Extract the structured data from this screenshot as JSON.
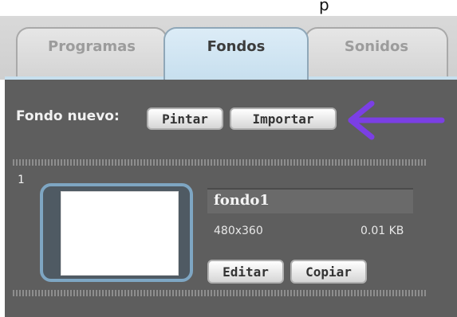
{
  "tabs": [
    {
      "label": "Programas",
      "active": false
    },
    {
      "label": "Fondos",
      "active": true
    },
    {
      "label": "Sonidos",
      "active": false
    }
  ],
  "new_background": {
    "label": "Fondo nuevo:",
    "paint_button": "Pintar",
    "import_button": "Importar"
  },
  "background_item": {
    "index": "1",
    "name": "fondo1",
    "dimensions": "480x360",
    "size": "0.01 KB",
    "edit_button": "Editar",
    "copy_button": "Copiar"
  },
  "colors": {
    "arrow": "#7b3fe4",
    "panel": "#5e5e5e",
    "active_tab": "#c7dfee"
  }
}
